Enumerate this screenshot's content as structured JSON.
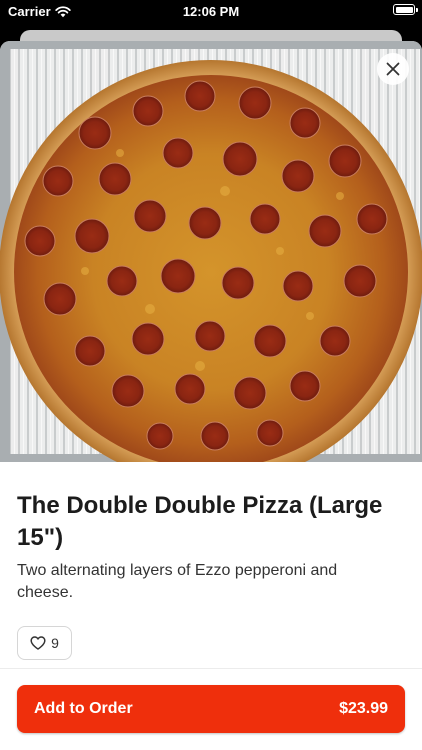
{
  "status_bar": {
    "carrier": "Carrier",
    "time": "12:06 PM",
    "icons": [
      "wifi-icon",
      "battery-icon"
    ]
  },
  "item": {
    "image_alt": "Pepperoni pizza",
    "title": "The Double Double Pizza (Large 15\")",
    "description": "Two alternating layers of Ezzo pepperoni and cheese.",
    "likes": "9"
  },
  "actions": {
    "close_icon": "close-icon",
    "like_icon": "heart-icon",
    "add_label": "Add to Order",
    "price": "$23.99"
  },
  "colors": {
    "accent": "#ef2f0c",
    "text": "#1c1c1c"
  }
}
